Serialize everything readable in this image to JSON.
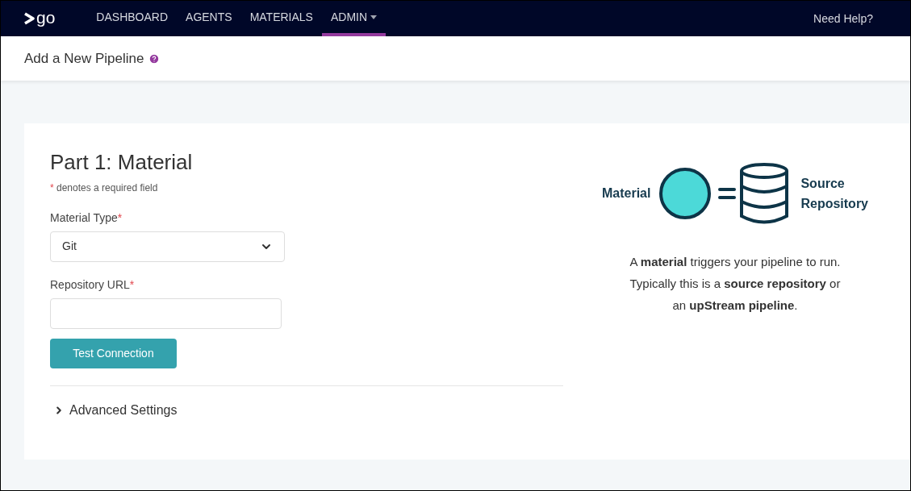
{
  "header": {
    "logo_text": "go",
    "nav": [
      {
        "label": "DASHBOARD",
        "selected": false,
        "has_menu": false
      },
      {
        "label": "AGENTS",
        "selected": false,
        "has_menu": false
      },
      {
        "label": "MATERIALS",
        "selected": false,
        "has_menu": false
      },
      {
        "label": "ADMIN",
        "selected": true,
        "has_menu": true
      }
    ],
    "help_link": "Need Help?"
  },
  "page_title": "Add a New Pipeline",
  "form": {
    "title": "Part 1: Material",
    "required_note": {
      "mark": "*",
      "text": "denotes a required field"
    },
    "fields": [
      {
        "kind": "select",
        "label": "Material Type",
        "required_mark": "*",
        "value": "Git"
      },
      {
        "kind": "text",
        "label": "Repository URL",
        "required_mark": "*"
      }
    ],
    "button": "Test Connection",
    "advanced": {
      "label": "Advanced Settings",
      "expanded": false
    }
  },
  "illustration": {
    "left_label": "Material",
    "right_label": [
      "Source",
      "Repository"
    ]
  },
  "description": [
    "A **material** triggers your pipeline to run.",
    "Typically this is a **source repository** or",
    "an **upStream pipeline**."
  ]
}
